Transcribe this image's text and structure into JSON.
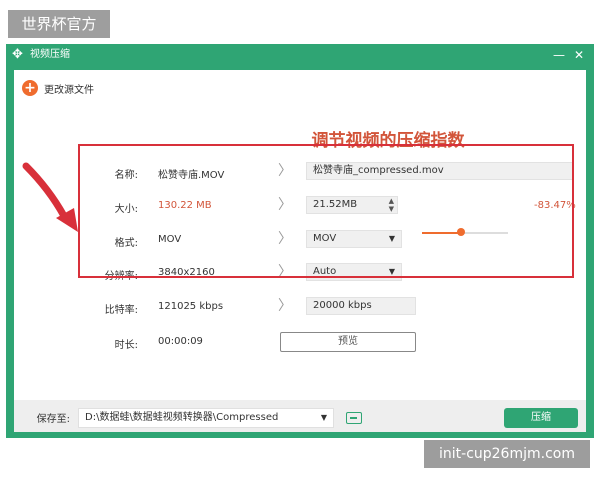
{
  "watermark_top": "世界杯官方",
  "watermark_bottom": "init-cup26mjm.com",
  "window": {
    "title": "视频压缩",
    "app_icon": "move-cross-icon",
    "minimize_glyph": "—",
    "close_glyph": "✕"
  },
  "toolbar": {
    "change_source_label": "更改源文件",
    "plus_glyph": "+"
  },
  "heading": "调节视频的压缩指数",
  "rows": {
    "name": {
      "label": "名称:",
      "original": "松赞寺庙.MOV",
      "output": "松赞寺庙_compressed.mov"
    },
    "size": {
      "label": "大小:",
      "original": "130.22 MB",
      "output": "21.52MB",
      "percent_text": "-83.47%",
      "slider_level": 0.45
    },
    "format": {
      "label": "格式:",
      "original": "MOV",
      "output": "MOV"
    },
    "resolution": {
      "label": "分辨率:",
      "original": "3840x2160",
      "output": "Auto"
    },
    "bitrate": {
      "label": "比特率:",
      "original": "121025 kbps",
      "output": "20000 kbps"
    },
    "duration": {
      "label": "时长:",
      "value": "00:00:09"
    }
  },
  "arrow_glyph": "〉",
  "preview_label": "预览",
  "footer": {
    "save_label": "保存至:",
    "save_path": "D:\\数据蛙\\数据蛙视频转换器\\Compressed",
    "compress_label": "压缩"
  },
  "colors": {
    "brand_green": "#2fa574",
    "accent_orange": "#ef6c2e",
    "highlight_red": "#d8303a",
    "heading_red": "#d2553a"
  }
}
